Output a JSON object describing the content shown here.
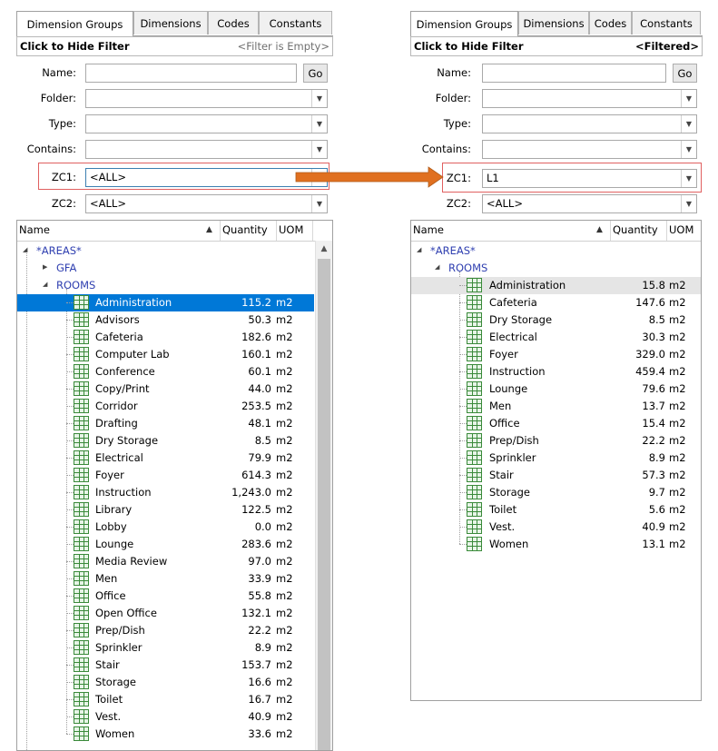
{
  "tabs": [
    "Dimension Groups",
    "Dimensions",
    "Codes",
    "Constants"
  ],
  "left": {
    "filter_title": "Click to Hide Filter",
    "filter_status": "<Filter is Empty>",
    "go_label": "Go",
    "fields": {
      "name": {
        "label": "Name:",
        "value": ""
      },
      "folder": {
        "label": "Folder:",
        "value": ""
      },
      "type": {
        "label": "Type:",
        "value": ""
      },
      "contains": {
        "label": "Contains:",
        "value": ""
      },
      "zc1": {
        "label": "ZC1:",
        "value": "<ALL>"
      },
      "zc2": {
        "label": "ZC2:",
        "value": "<ALL>"
      }
    },
    "columns": {
      "name": "Name",
      "quantity": "Quantity",
      "uom": "UOM"
    },
    "groups": [
      {
        "name": "*AREAS*",
        "level": 0,
        "expanded": true
      },
      {
        "name": "GFA",
        "level": 1,
        "expanded": false
      },
      {
        "name": "ROOMS",
        "level": 1,
        "expanded": true
      }
    ],
    "rooms": [
      {
        "name": "Administration",
        "qty": "115.2",
        "uom": "m2"
      },
      {
        "name": "Advisors",
        "qty": "50.3",
        "uom": "m2"
      },
      {
        "name": "Cafeteria",
        "qty": "182.6",
        "uom": "m2"
      },
      {
        "name": "Computer Lab",
        "qty": "160.1",
        "uom": "m2"
      },
      {
        "name": "Conference",
        "qty": "60.1",
        "uom": "m2"
      },
      {
        "name": "Copy/Print",
        "qty": "44.0",
        "uom": "m2"
      },
      {
        "name": "Corridor",
        "qty": "253.5",
        "uom": "m2"
      },
      {
        "name": "Drafting",
        "qty": "48.1",
        "uom": "m2"
      },
      {
        "name": "Dry Storage",
        "qty": "8.5",
        "uom": "m2"
      },
      {
        "name": "Electrical",
        "qty": "79.9",
        "uom": "m2"
      },
      {
        "name": "Foyer",
        "qty": "614.3",
        "uom": "m2"
      },
      {
        "name": "Instruction",
        "qty": "1,243.0",
        "uom": "m2"
      },
      {
        "name": "Library",
        "qty": "122.5",
        "uom": "m2"
      },
      {
        "name": "Lobby",
        "qty": "0.0",
        "uom": "m2"
      },
      {
        "name": "Lounge",
        "qty": "283.6",
        "uom": "m2"
      },
      {
        "name": "Media Review",
        "qty": "97.0",
        "uom": "m2"
      },
      {
        "name": "Men",
        "qty": "33.9",
        "uom": "m2"
      },
      {
        "name": "Office",
        "qty": "55.8",
        "uom": "m2"
      },
      {
        "name": "Open Office",
        "qty": "132.1",
        "uom": "m2"
      },
      {
        "name": "Prep/Dish",
        "qty": "22.2",
        "uom": "m2"
      },
      {
        "name": "Sprinkler",
        "qty": "8.9",
        "uom": "m2"
      },
      {
        "name": "Stair",
        "qty": "153.7",
        "uom": "m2"
      },
      {
        "name": "Storage",
        "qty": "16.6",
        "uom": "m2"
      },
      {
        "name": "Toilet",
        "qty": "16.7",
        "uom": "m2"
      },
      {
        "name": "Vest.",
        "qty": "40.9",
        "uom": "m2"
      },
      {
        "name": "Women",
        "qty": "33.6",
        "uom": "m2"
      }
    ]
  },
  "right": {
    "filter_title": "Click to Hide Filter",
    "filter_status": "<Filtered>",
    "go_label": "Go",
    "fields": {
      "name": {
        "label": "Name:",
        "value": ""
      },
      "folder": {
        "label": "Folder:",
        "value": ""
      },
      "type": {
        "label": "Type:",
        "value": ""
      },
      "contains": {
        "label": "Contains:",
        "value": ""
      },
      "zc1": {
        "label": "ZC1:",
        "value": "L1"
      },
      "zc2": {
        "label": "ZC2:",
        "value": "<ALL>"
      }
    },
    "columns": {
      "name": "Name",
      "quantity": "Quantity",
      "uom": "UOM"
    },
    "groups": [
      {
        "name": "*AREAS*",
        "level": 0,
        "expanded": true
      },
      {
        "name": "ROOMS",
        "level": 1,
        "expanded": true
      }
    ],
    "rooms": [
      {
        "name": "Administration",
        "qty": "15.8",
        "uom": "m2"
      },
      {
        "name": "Cafeteria",
        "qty": "147.6",
        "uom": "m2"
      },
      {
        "name": "Dry Storage",
        "qty": "8.5",
        "uom": "m2"
      },
      {
        "name": "Electrical",
        "qty": "30.3",
        "uom": "m2"
      },
      {
        "name": "Foyer",
        "qty": "329.0",
        "uom": "m2"
      },
      {
        "name": "Instruction",
        "qty": "459.4",
        "uom": "m2"
      },
      {
        "name": "Lounge",
        "qty": "79.6",
        "uom": "m2"
      },
      {
        "name": "Men",
        "qty": "13.7",
        "uom": "m2"
      },
      {
        "name": "Office",
        "qty": "15.4",
        "uom": "m2"
      },
      {
        "name": "Prep/Dish",
        "qty": "22.2",
        "uom": "m2"
      },
      {
        "name": "Sprinkler",
        "qty": "8.9",
        "uom": "m2"
      },
      {
        "name": "Stair",
        "qty": "57.3",
        "uom": "m2"
      },
      {
        "name": "Storage",
        "qty": "9.7",
        "uom": "m2"
      },
      {
        "name": "Toilet",
        "qty": "5.6",
        "uom": "m2"
      },
      {
        "name": "Vest.",
        "qty": "40.9",
        "uom": "m2"
      },
      {
        "name": "Women",
        "qty": "13.1",
        "uom": "m2"
      }
    ]
  },
  "colors": {
    "selection": "#0078d7",
    "folder_text": "#2f3fb0",
    "highlight": "#e06060",
    "arrow": "#e07020",
    "icon": "#3a8a3a"
  },
  "icons": {
    "room": "grid-icon",
    "expanded": "triangle-expanded-icon",
    "collapsed": "triangle-collapsed-icon",
    "dropdown": "chevron-down-icon",
    "sort": "sort-ascending-icon"
  }
}
